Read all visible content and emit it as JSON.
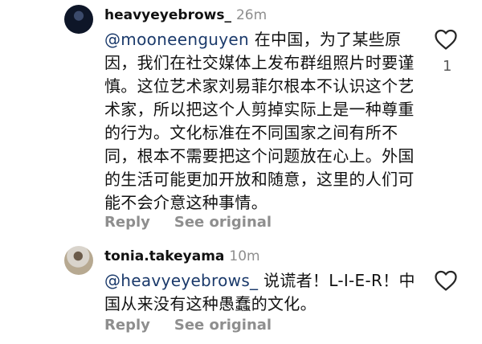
{
  "comments": [
    {
      "username": "heavyeyebrows_",
      "time": "26m",
      "mention": "@mooneenguyen",
      "text": "在中国，为了某些原因，我们在社交媒体上发布群组照片时要谨慎。这位艺术家刘易菲尔根本不认识这个艺术家，所以把这个人剪掉实际上是一种尊重的行为。文化标准在不同国家之间有所不同，根本不需要把这个问题放在心上。外国的生活可能更加开放和随意，这里的人们可能不会介意这种事情。",
      "reply_label": "Reply",
      "see_original_label": "See original",
      "like_count": "1",
      "avatar_icon": "profile-photo-dark",
      "heart_icon": "heart-outline-icon"
    },
    {
      "username": "tonia.takeyama",
      "time": "10m",
      "mention": "@heavyeyebrows_",
      "text": "说谎者！L-I-E-R！中国从来没有这种愚蠢的文化。",
      "reply_label": "Reply",
      "see_original_label": "See original",
      "like_count": "",
      "avatar_icon": "profile-photo-light",
      "heart_icon": "heart-outline-icon"
    }
  ],
  "colors": {
    "username": "#111111",
    "timestamp": "#8e8e8e",
    "mention": "#1b3a6b",
    "action_text": "#8e8e8e",
    "heart_stroke": "#262626"
  }
}
